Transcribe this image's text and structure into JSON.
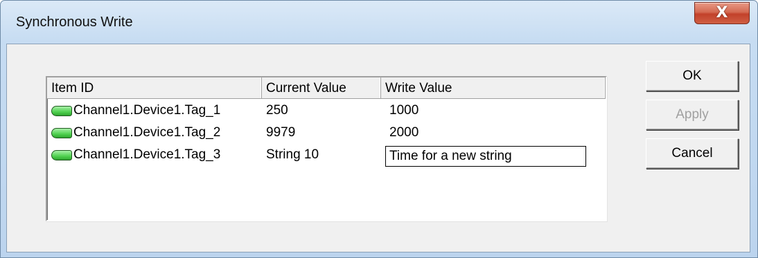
{
  "window": {
    "title": "Synchronous Write",
    "close_symbol": "X"
  },
  "listview": {
    "columns": [
      "Item ID",
      "Current Value",
      "Write Value"
    ],
    "rows": [
      {
        "icon": "tag-icon",
        "item_id": "Channel1.Device1.Tag_1",
        "current_value": "250",
        "write_value": "1000"
      },
      {
        "icon": "tag-icon",
        "item_id": "Channel1.Device1.Tag_2",
        "current_value": "9979",
        "write_value": "2000"
      },
      {
        "icon": "tag-icon",
        "item_id": "Channel1.Device1.Tag_3",
        "current_value": "String 10",
        "write_value": "Time for a new string"
      }
    ]
  },
  "buttons": {
    "ok": "OK",
    "apply": "Apply",
    "cancel": "Cancel"
  },
  "colors": {
    "close_button": "#c2412a",
    "tag_icon": "#4fd14f"
  }
}
